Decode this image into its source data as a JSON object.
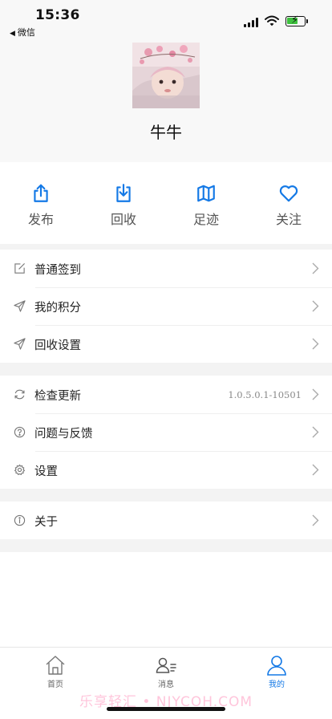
{
  "status_bar": {
    "time": "15:36",
    "back_app": "微信"
  },
  "profile": {
    "username": "牛牛"
  },
  "actions": [
    {
      "label": "发布",
      "icon": "upload-icon"
    },
    {
      "label": "回收",
      "icon": "download-icon"
    },
    {
      "label": "足迹",
      "icon": "map-icon"
    },
    {
      "label": "关注",
      "icon": "heart-icon"
    }
  ],
  "menu_group_1": [
    {
      "label": "普通签到",
      "icon": "edit-icon"
    },
    {
      "label": "我的积分",
      "icon": "send-icon"
    },
    {
      "label": "回收设置",
      "icon": "send-icon"
    }
  ],
  "menu_group_2": [
    {
      "label": "检查更新",
      "icon": "refresh-icon",
      "value": "1.0.5.0.1-10501"
    },
    {
      "label": "问题与反馈",
      "icon": "question-icon"
    },
    {
      "label": "设置",
      "icon": "gear-icon"
    }
  ],
  "menu_group_3": [
    {
      "label": "关于",
      "icon": "info-icon"
    }
  ],
  "tabbar": {
    "items": [
      {
        "label": "首页",
        "icon": "home-icon"
      },
      {
        "label": "消息",
        "icon": "message-icon"
      },
      {
        "label": "我的",
        "icon": "user-icon",
        "active": true
      }
    ]
  },
  "watermark": "乐享轻汇 • NJYCOH.COM",
  "colors": {
    "accent": "#1479e6",
    "background": "#f3f3f3",
    "battery_green": "#3ec13e"
  }
}
